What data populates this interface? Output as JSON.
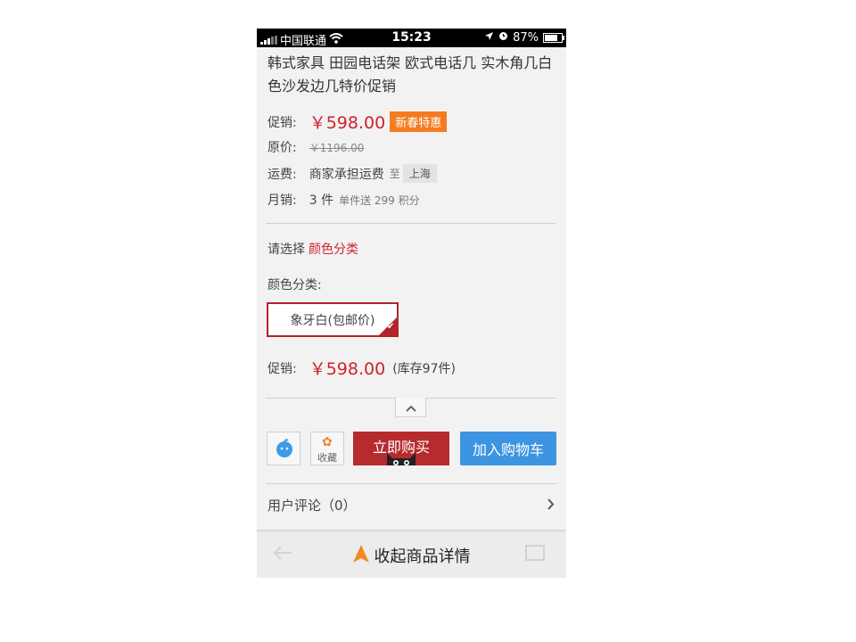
{
  "status_bar": {
    "carrier": "中国联通",
    "time": "15:23",
    "battery": "87%"
  },
  "product": {
    "title": "韩式家具 田园电话架 欧式电话几 实木角几白色沙发边几特价促销"
  },
  "pricing": {
    "promo_label": "促销:",
    "promo_price": "￥598.00",
    "promo_badge": "新春特惠",
    "original_label": "原价:",
    "original_price": "￥1196.00",
    "shipping_label": "运费:",
    "shipping_text": "商家承担运费",
    "shipping_to": "至",
    "shipping_city": "上海",
    "monthly_label": "月销:",
    "monthly_count": "3 件",
    "monthly_points": "单件送 299 积分"
  },
  "selection": {
    "prompt": "请选择",
    "prompt_highlight": "颜色分类",
    "color_label": "颜色分类:",
    "color_option": "象牙白(包邮价)",
    "selected_price_label": "促销:",
    "selected_price": "￥598.00",
    "stock": "(库存97件)"
  },
  "actions": {
    "favorite_label": "收藏",
    "buy_now": "立即购买",
    "add_to_cart": "加入购物车"
  },
  "reviews": {
    "label": "用户评论（0）"
  },
  "bottom_bar": {
    "collapse_label": "收起商品详情"
  },
  "colors": {
    "accent_red": "#d0232a",
    "badge_orange": "#f47b20",
    "buy_red": "#b62b2e",
    "cart_blue": "#3d95e1"
  }
}
